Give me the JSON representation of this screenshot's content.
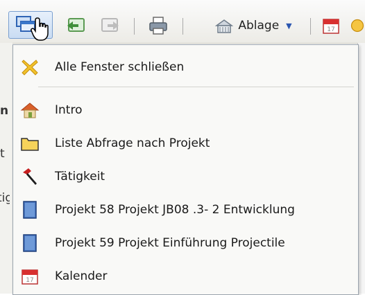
{
  "toolbar": {
    "ablage_label": "Ablage",
    "icons": [
      "windows-icon",
      "back-icon",
      "forward-icon",
      "print-icon",
      "ablage-icon",
      "calendar-icon"
    ]
  },
  "background_fragments": [
    "n",
    "t",
    "tig"
  ],
  "menu": {
    "close_all": {
      "label": "Alle Fenster schließen",
      "icon": "close-x-icon"
    },
    "items": [
      {
        "label": "Intro",
        "icon": "home-icon"
      },
      {
        "label": "Liste Abfrage nach Projekt",
        "icon": "folder-icon"
      },
      {
        "label": "Tätigkeit",
        "icon": "hammer-icon"
      },
      {
        "label": "Projekt 58 Projekt JB08 .3- 2 Entwicklung",
        "icon": "project-book-icon"
      },
      {
        "label": "Projekt 59 Projekt Einführung Projectile",
        "icon": "project-book-icon"
      },
      {
        "label": "Kalender",
        "icon": "calendar-icon"
      }
    ]
  }
}
